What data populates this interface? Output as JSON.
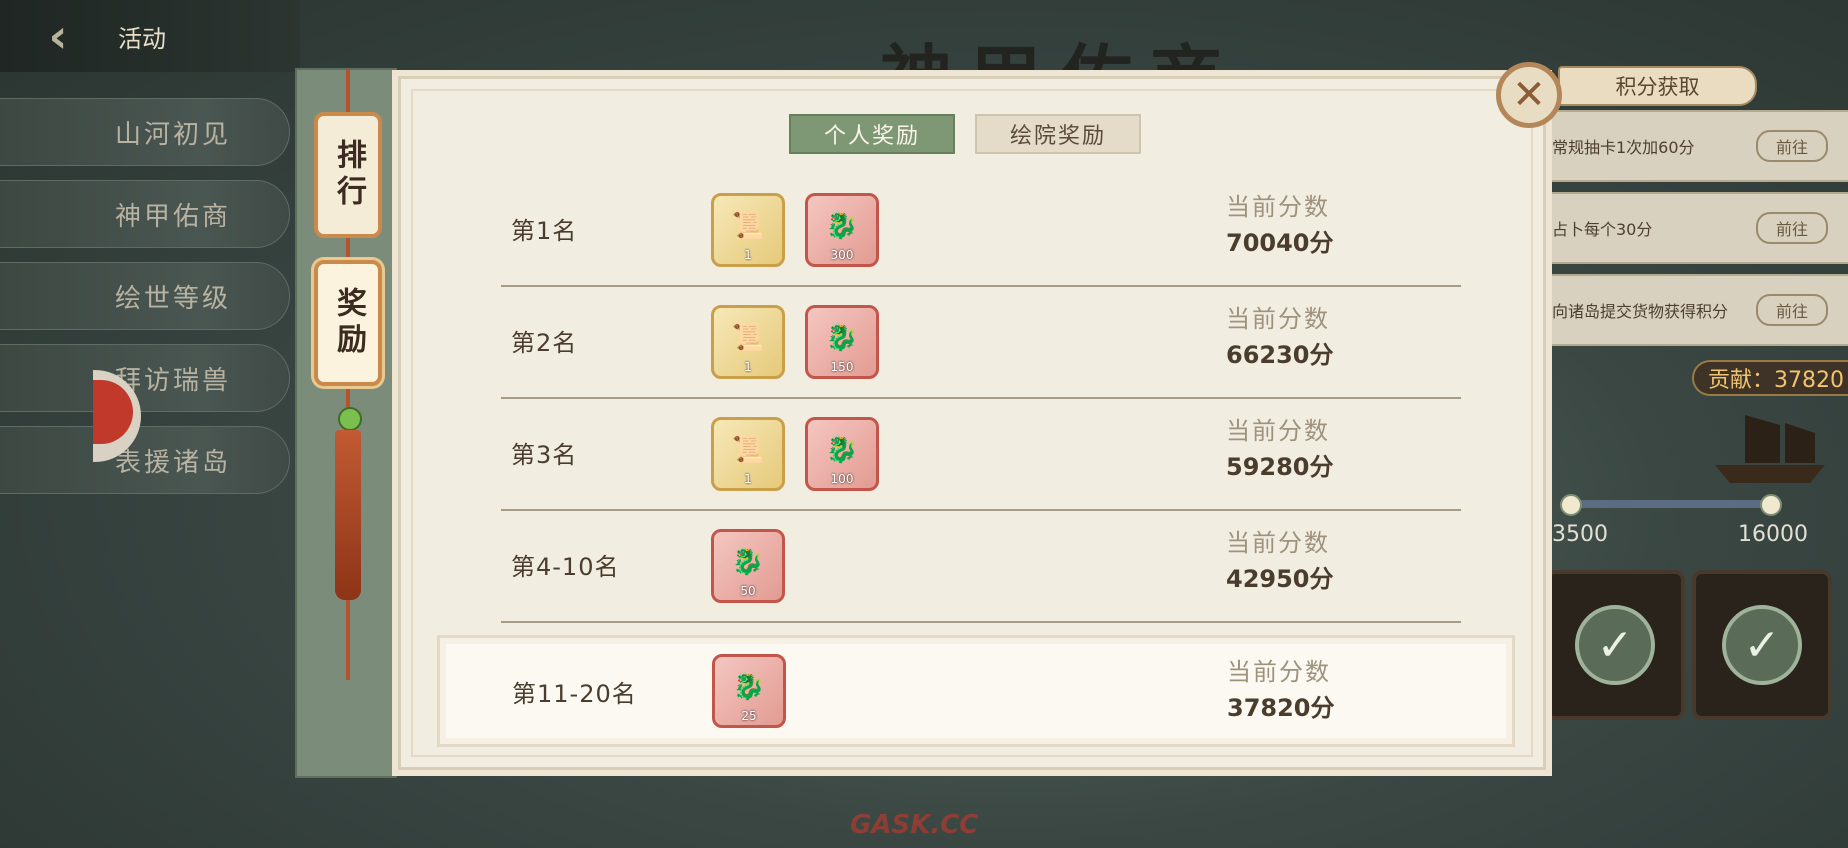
{
  "header": {
    "back_icon": "chevron-left-icon",
    "title": "活动"
  },
  "background_title": "神甲佑商",
  "sidebar": {
    "items": [
      {
        "label": "山河初见"
      },
      {
        "label": "神甲佑商"
      },
      {
        "label": "绘世等级"
      },
      {
        "label": "拜访瑞兽"
      },
      {
        "label": "表援诸岛"
      }
    ]
  },
  "rail": {
    "tabs": [
      {
        "label": "排行"
      },
      {
        "label": "奖励"
      }
    ],
    "active": "奖励"
  },
  "modal": {
    "tabs": [
      {
        "label": "个人奖励",
        "active": true
      },
      {
        "label": "绘院奖励",
        "active": false
      }
    ],
    "close_icon": "close-icon",
    "score_label": "当前分数",
    "ranks": [
      {
        "name": "第1名",
        "items": [
          {
            "type": "gold",
            "icon": "scroll-icon",
            "count": "1"
          },
          {
            "type": "red",
            "icon": "dragon-icon",
            "count": "300"
          }
        ],
        "score": "70040分"
      },
      {
        "name": "第2名",
        "items": [
          {
            "type": "gold",
            "icon": "scroll-icon",
            "count": "1"
          },
          {
            "type": "red",
            "icon": "dragon-icon",
            "count": "150"
          }
        ],
        "score": "66230分"
      },
      {
        "name": "第3名",
        "items": [
          {
            "type": "gold",
            "icon": "scroll-icon",
            "count": "1"
          },
          {
            "type": "red",
            "icon": "dragon-icon",
            "count": "100"
          }
        ],
        "score": "59280分"
      },
      {
        "name": "第4-10名",
        "items": [
          {
            "type": "red",
            "icon": "dragon-icon",
            "count": "50"
          }
        ],
        "score": "42950分"
      }
    ],
    "my_rank": {
      "name": "第11-20名",
      "items": [
        {
          "type": "red",
          "icon": "dragon-icon",
          "count": "25"
        }
      ],
      "score": "37820分"
    }
  },
  "points_panel": {
    "title": "积分获取",
    "rows": [
      {
        "text": "常规抽卡1次加60分",
        "button": "前往"
      },
      {
        "text": "占卜每个30分",
        "button": "前往"
      },
      {
        "text": "向诸岛提交货物获得积分",
        "button": "前往"
      }
    ],
    "contribution": "贡献：37820",
    "milestones": [
      "3500",
      "16000"
    ]
  },
  "watermark": "GASK.CC",
  "colors": {
    "active_tab": "#7e9774",
    "modal_bg": "#f2ede1",
    "accent_red": "#c2564b",
    "accent_gold": "#c9a049"
  }
}
